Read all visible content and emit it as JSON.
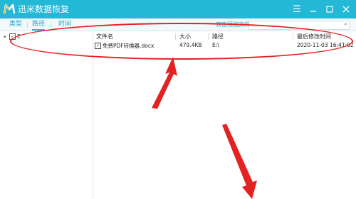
{
  "app": {
    "title": "迅米数据恢复"
  },
  "tabs": [
    "类型",
    "路径",
    "时间"
  ],
  "toolbar": {
    "preview_link": "双击预览文件"
  },
  "tree": {
    "root_label": "E"
  },
  "table": {
    "headers": {
      "name": "文件名",
      "size": "大小",
      "path": "路径",
      "modified": "最后修改时间"
    },
    "rows": [
      {
        "name": "免费PDF转换器.docx",
        "size": "479.4KB",
        "path": "E:\\",
        "modified": "2020-11-03 16:41:02"
      }
    ]
  },
  "colors": {
    "titlebar": "#22b8d6",
    "annotation": "#e32222"
  }
}
